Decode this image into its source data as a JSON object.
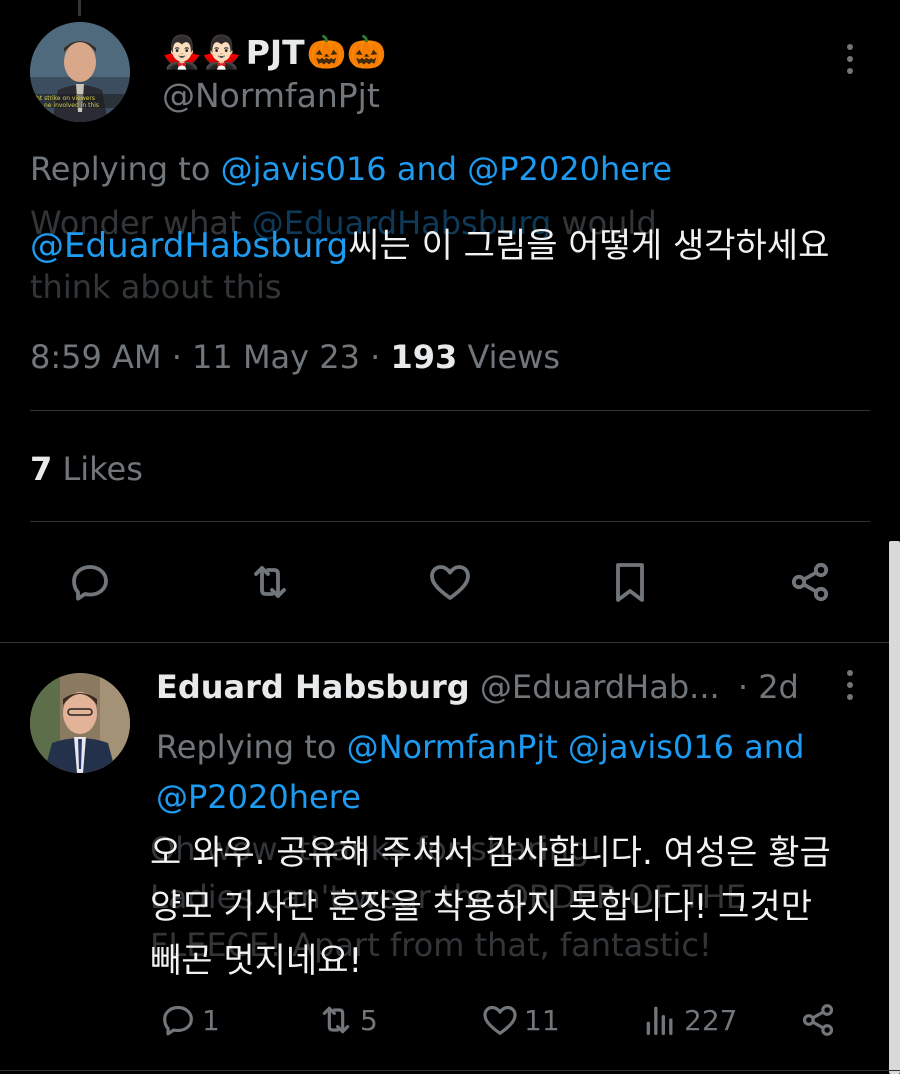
{
  "main_tweet": {
    "display_name": "PJT",
    "name_emoji_before": "🧛🏻‍♂️🧛🏻‍♂️",
    "name_emoji_after": "🎃🎃",
    "handle": "@NormfanPjt",
    "replying_prefix": "Replying to",
    "replying_user1": "@javis016",
    "replying_and": "and",
    "replying_user2": "@P2020here",
    "text_mention": "@EduardHabsburg",
    "text_body": "씨는 이 그림을 어떻게 생각하세요",
    "ghost_line1_a": "Wonder what",
    "ghost_line1_b": "@EduardHabsburg",
    "ghost_line1_c": "would",
    "ghost_line2": "think about this",
    "time": "8:59 AM",
    "date": "11 May 23",
    "views_count": "193",
    "views_label": "Views",
    "likes_count": "7",
    "likes_label": "Likes"
  },
  "actions": {
    "reply_icon": "reply-icon",
    "retweet_icon": "retweet-icon",
    "like_icon": "heart-icon",
    "bookmark_icon": "bookmark-icon",
    "share_icon": "share-icon"
  },
  "reply_tweet": {
    "display_name": "Eduard Habsburg",
    "handle": "@EduardHab...",
    "age": "· 2d",
    "replying_prefix": "Replying to",
    "replying_user1": "@NormfanPjt",
    "replying_user2": "@javis016",
    "replying_and": "and",
    "replying_user3": "@P2020here",
    "text": "오 와우. 공유해 주셔서 감사합니다. 여성은 황금양모 기사단 훈장을 착용하지 못합니다! 그것만 빼곤 멋지네요!",
    "ghost_line1": "Oh wow, thanks for sharing!",
    "ghost_line2": "Ladies can't wear the ORDER OF THE",
    "ghost_line3": "FLEECE! Apart from that, fantastic!",
    "reply_count": "1",
    "retweet_count": "5",
    "like_count": "11",
    "views_count": "227"
  },
  "colors": {
    "background": "#000000",
    "text_primary": "#e7e9ea",
    "text_secondary": "#71767b",
    "link": "#1d9bf0",
    "divider": "#2f3336"
  }
}
